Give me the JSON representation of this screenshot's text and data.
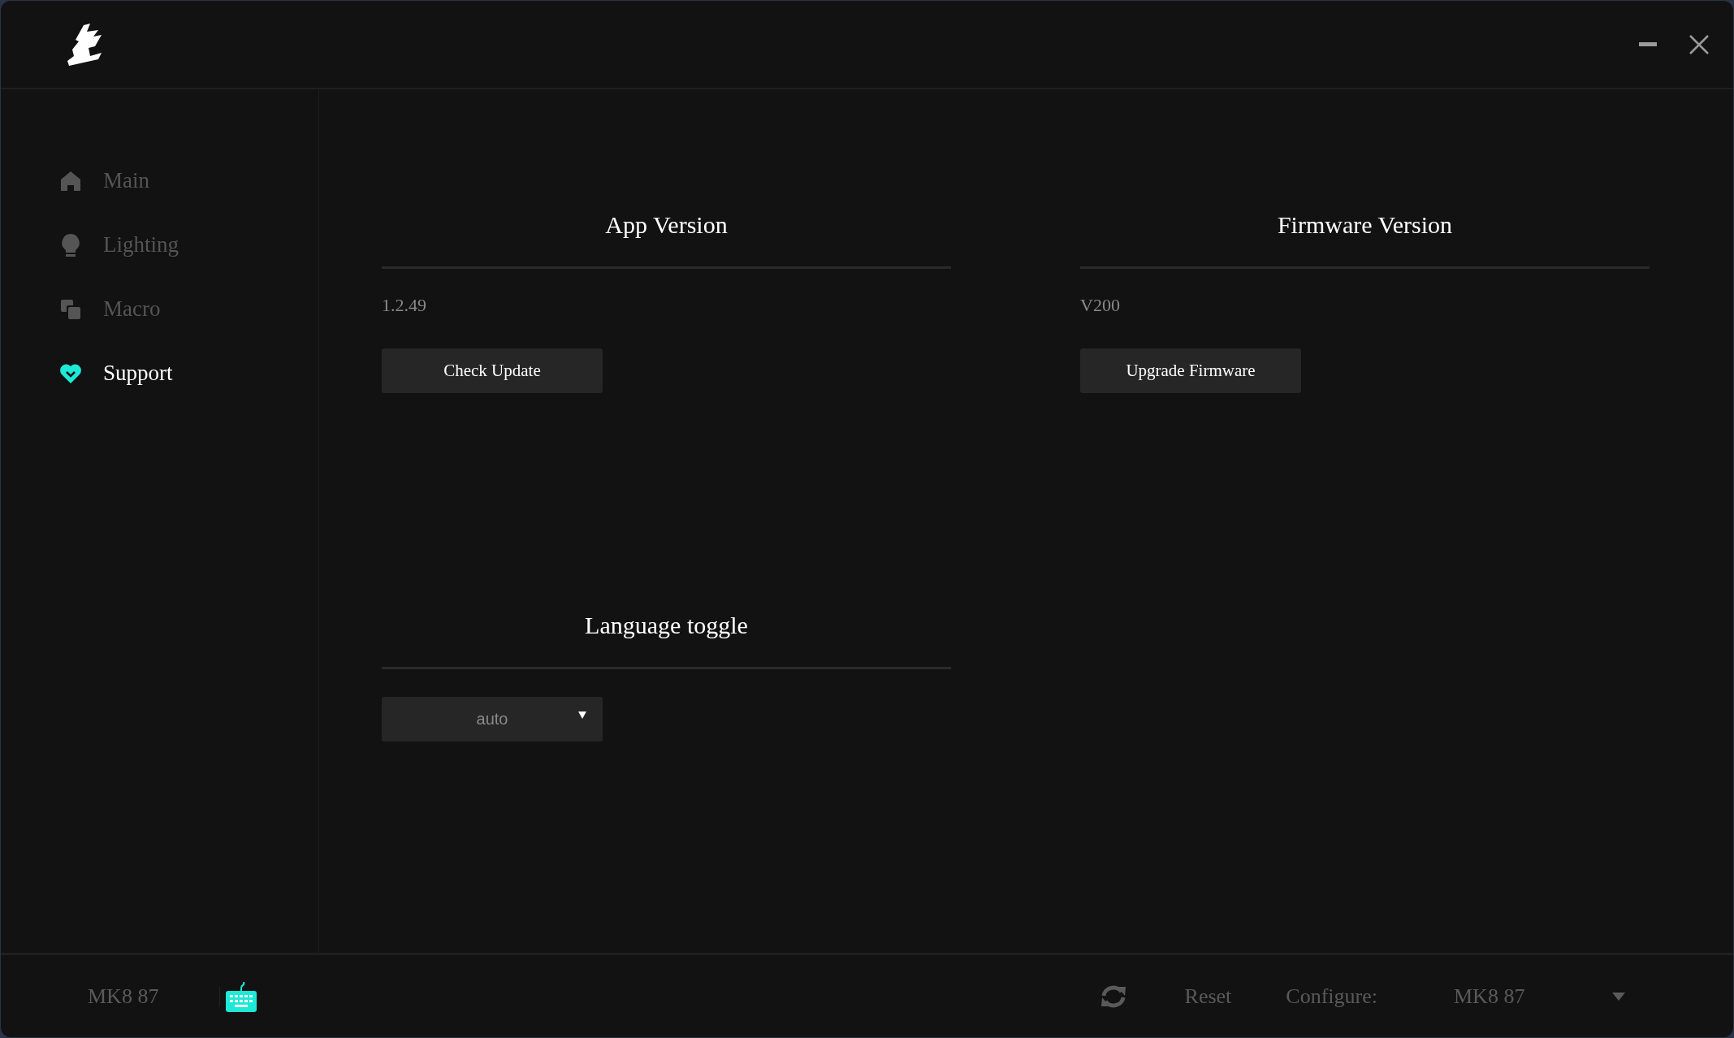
{
  "sidebar": {
    "items": [
      {
        "label": "Main",
        "selected": false
      },
      {
        "label": "Lighting",
        "selected": false
      },
      {
        "label": "Macro",
        "selected": false
      },
      {
        "label": "Support",
        "selected": true
      }
    ]
  },
  "sections": [
    {
      "kind": "version",
      "title": "App Version",
      "value": "1.2.49",
      "button": "Check Update"
    },
    {
      "kind": "version",
      "title": "Firmware Version",
      "value": "V200",
      "button": "Upgrade Firmware"
    },
    {
      "kind": "dropdown",
      "title": "Language toggle",
      "value": "auto"
    }
  ],
  "footer": {
    "device": "MK8 87",
    "reset": "Reset",
    "configure_label": "Configure:",
    "configure_value": "MK8 87"
  }
}
